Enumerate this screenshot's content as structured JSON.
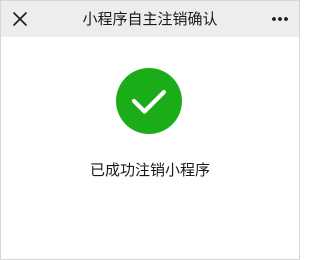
{
  "nav": {
    "close_icon": "close-icon",
    "title": "小程序自主注销确认",
    "more_icon": "more-icon"
  },
  "result": {
    "icon": "success-check-icon",
    "icon_color": "#1aad19",
    "message": "已成功注销小程序"
  }
}
